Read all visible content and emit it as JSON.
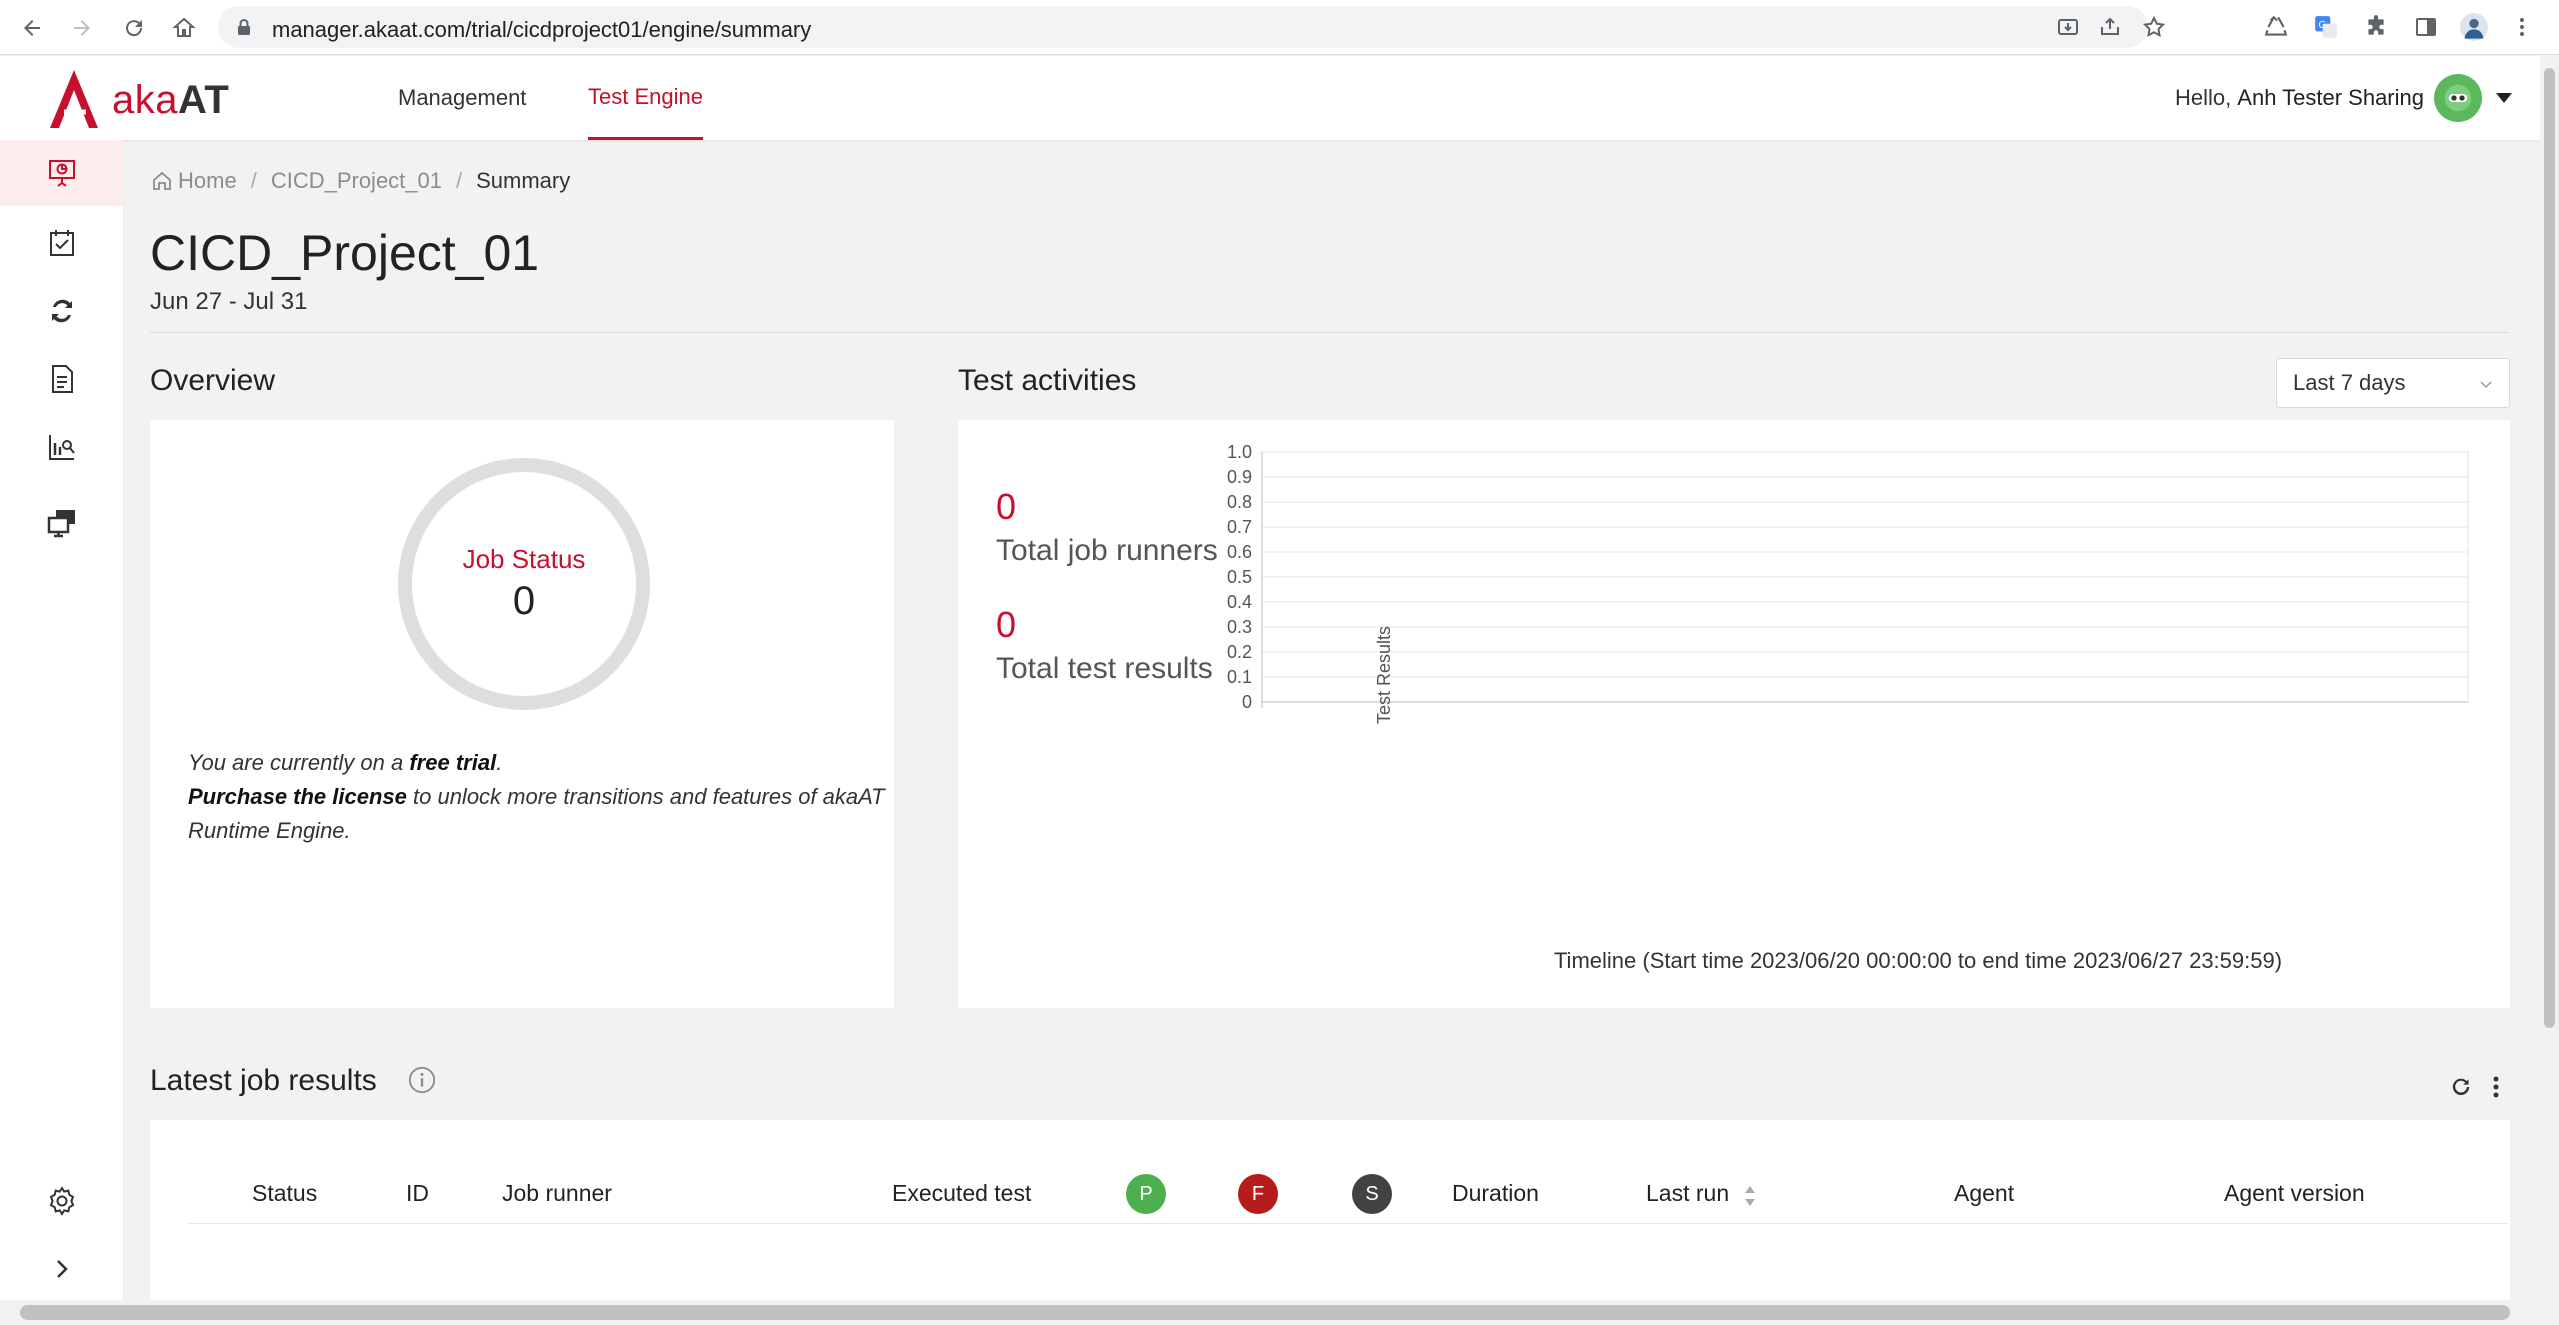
{
  "browser": {
    "url": "manager.akaat.com/trial/cicdproject01/engine/summary"
  },
  "app": {
    "logo_prefix": "aka",
    "logo_suffix": "AT",
    "nav": [
      "Management",
      "Test Engine"
    ],
    "greeting": "Hello,",
    "user_name": "Anh Tester Sharing"
  },
  "breadcrumb": {
    "home": "Home",
    "project": "CICD_Project_01",
    "current": "Summary"
  },
  "page": {
    "title": "CICD_Project_01",
    "dates": "Jun 27 - Jul 31"
  },
  "overview": {
    "title": "Overview",
    "ring_label": "Job Status",
    "ring_value": "0",
    "trial_line1_prefix": "You are currently on a ",
    "trial_line1_bold": "free trial",
    "trial_line1_suffix": ".",
    "trial_line2_bold": "Purchase the license",
    "trial_line2_rest": " to unlock more transitions and features of akaAT Runtime Engine."
  },
  "activities": {
    "title": "Test activities",
    "range": "Last 7 days",
    "total_job_runners_value": "0",
    "total_job_runners_label": "Total job runners",
    "total_test_results_value": "0",
    "total_test_results_label": "Total test results"
  },
  "chart_data": {
    "type": "line",
    "title": "",
    "xlabel": "Timeline (Start time 2023/06/20 00:00:00 to end time 2023/06/27 23:59:59)",
    "ylabel": "Test Results",
    "ylim": [
      0,
      1
    ],
    "yticks": [
      "0",
      "0.1",
      "0.2",
      "0.3",
      "0.4",
      "0.5",
      "0.6",
      "0.7",
      "0.8",
      "0.9",
      "1.0"
    ],
    "series": [],
    "grid": true
  },
  "latest": {
    "title": "Latest job results",
    "columns": {
      "status": "Status",
      "id": "ID",
      "job_runner": "Job runner",
      "executed_test": "Executed test",
      "passed": "P",
      "failed": "F",
      "skipped": "S",
      "duration": "Duration",
      "last_run": "Last run",
      "agent": "Agent",
      "agent_version": "Agent version"
    },
    "badge_colors": {
      "passed": "#4caf50",
      "failed": "#b71c1c",
      "skipped": "#424242"
    }
  },
  "colors": {
    "accent": "#c8102e"
  }
}
